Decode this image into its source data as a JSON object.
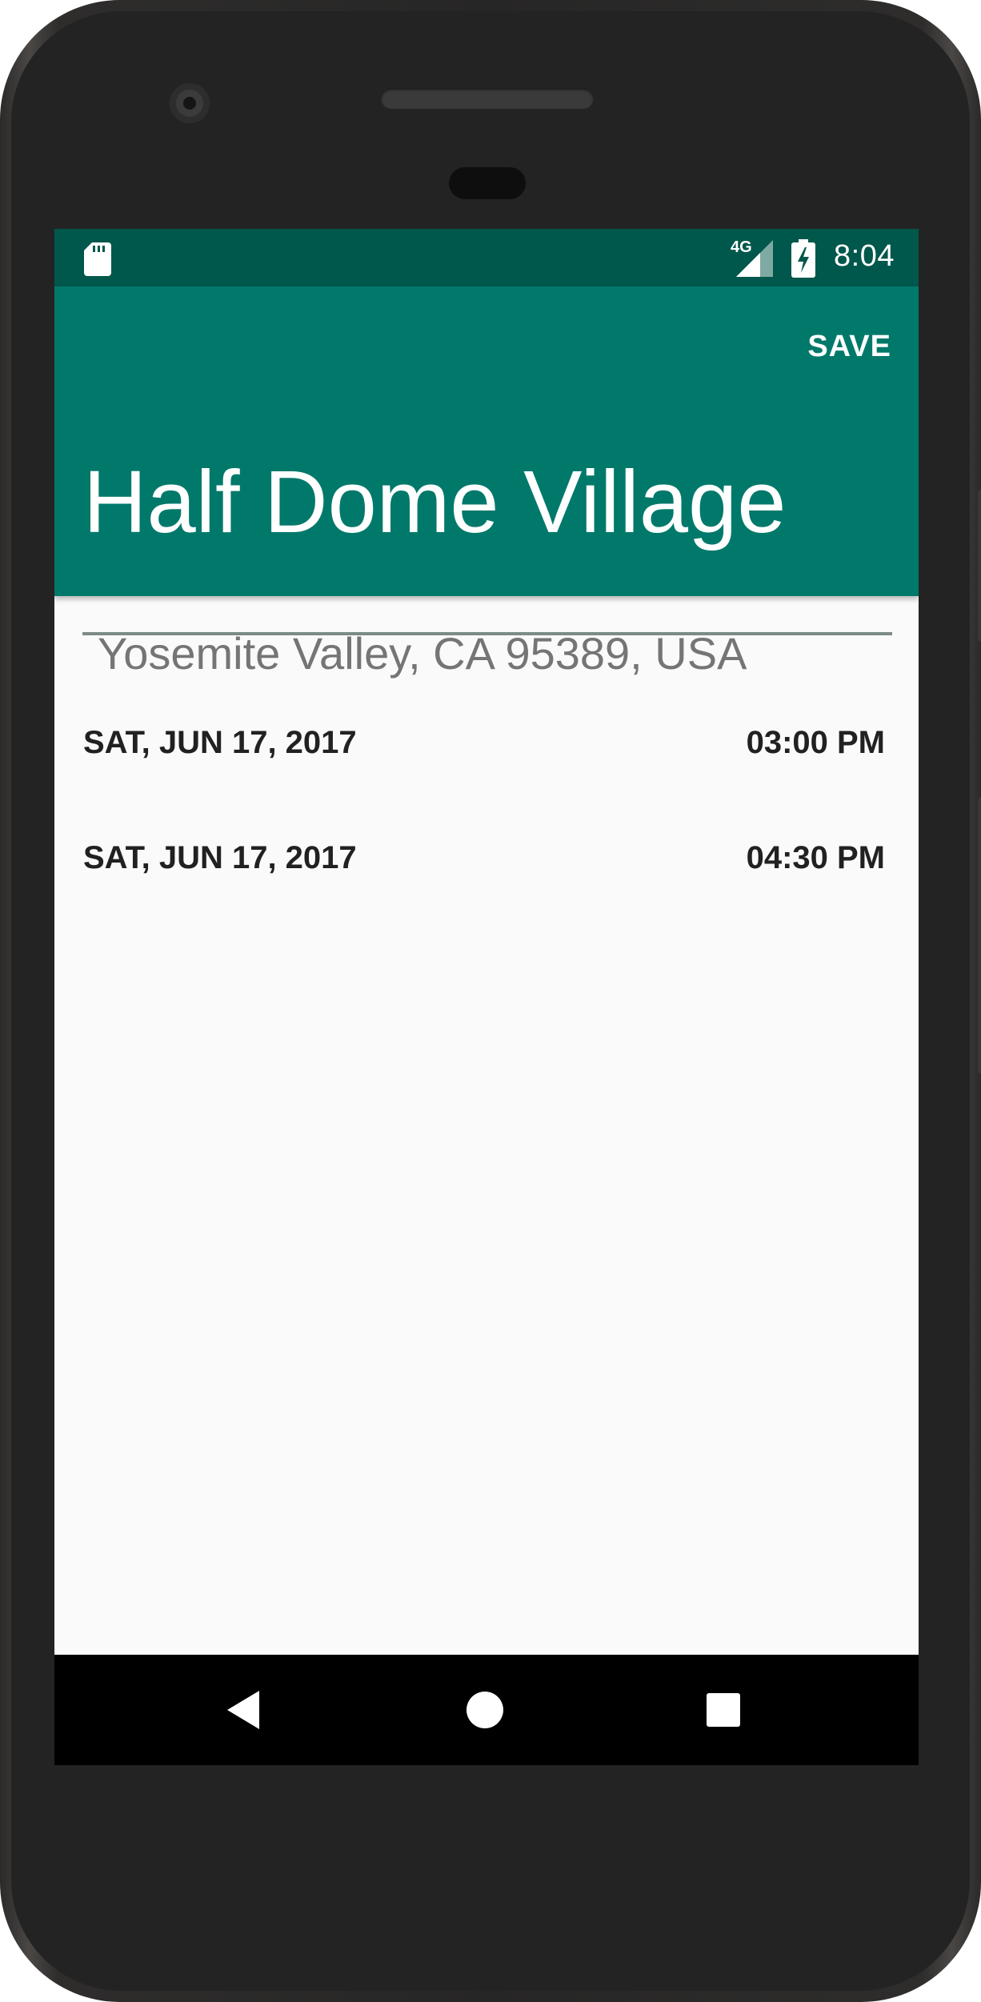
{
  "status_bar": {
    "network_label": "4G",
    "time": "8:04",
    "icons": [
      "sd-card-icon",
      "signal-icon",
      "battery-charging-icon"
    ]
  },
  "app_bar": {
    "save_label": "SAVE",
    "title_value": "Half Dome Village",
    "color": "#00796b",
    "status_color": "#00574b"
  },
  "content": {
    "address": "Yosemite Valley, CA 95389, USA",
    "rows": [
      {
        "date": "SAT, JUN 17, 2017",
        "time": "03:00 PM"
      },
      {
        "date": "SAT, JUN 17, 2017",
        "time": "04:30 PM"
      }
    ]
  },
  "nav_bar": {
    "icons": [
      "back-icon",
      "home-icon",
      "recents-icon"
    ]
  }
}
